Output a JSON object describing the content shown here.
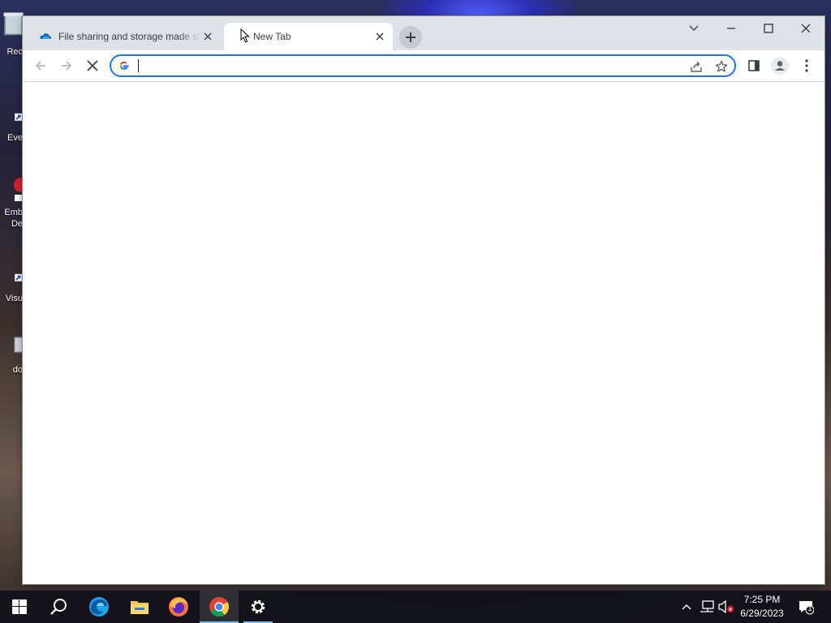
{
  "desktop": {
    "icons": [
      {
        "label": "Rec",
        "icon": "recycle-bin-icon"
      },
      {
        "label": "Eve",
        "icon": "shortcut-icon"
      },
      {
        "label": "Emb",
        "label2": "De",
        "icon": "shortcut-icon"
      },
      {
        "label": "Visu",
        "icon": "shortcut-icon"
      },
      {
        "label": "do",
        "icon": "document-icon"
      }
    ]
  },
  "browser": {
    "tabs": [
      {
        "title": "File sharing and storage made simple",
        "icon": "onedrive-icon",
        "active": false
      },
      {
        "title": "New Tab",
        "icon": "",
        "active": true
      }
    ],
    "omnibox": {
      "value": "",
      "placeholder": ""
    },
    "accent_color": "#1a73e8",
    "tabstrip_color": "#dee1e6"
  },
  "taskbar": {
    "apps": [
      {
        "name": "search",
        "icon": "search-icon"
      },
      {
        "name": "edge",
        "icon": "edge-icon"
      },
      {
        "name": "file-explorer",
        "icon": "folder-icon"
      },
      {
        "name": "firefox",
        "icon": "firefox-icon"
      },
      {
        "name": "chrome",
        "icon": "chrome-icon",
        "active": true
      },
      {
        "name": "settings",
        "icon": "gear-icon",
        "running": true
      }
    ],
    "clock": {
      "time": "7:25 PM",
      "date": "6/29/2023"
    },
    "notification_count": "1"
  }
}
